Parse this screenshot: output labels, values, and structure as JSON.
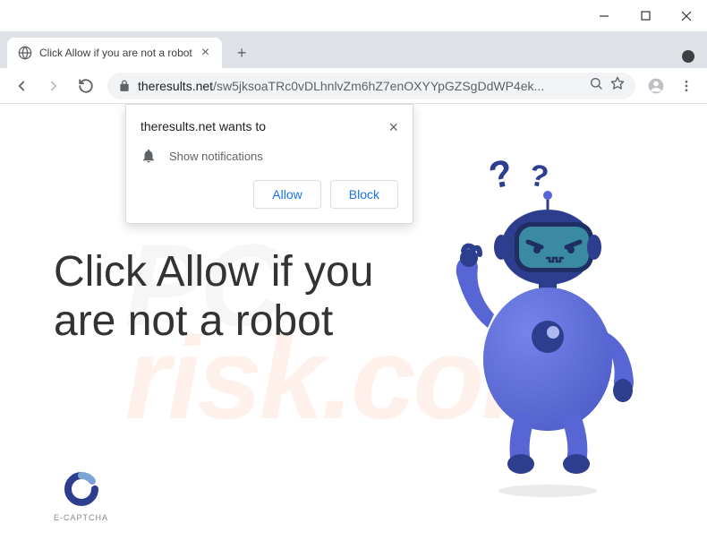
{
  "window": {
    "tab_title": "Click Allow if you are not a robot"
  },
  "addressbar": {
    "domain": "theresults.net",
    "path": "/sw5jksoaTRc0vDLhnlvZm6hZ7enOXYYpGZSgDdWP4ek..."
  },
  "notification": {
    "origin_text": "theresults.net wants to",
    "permission_text": "Show notifications",
    "allow_label": "Allow",
    "block_label": "Block"
  },
  "page": {
    "heading": "Click Allow if you are not a robot",
    "captcha_label": "E-CAPTCHA"
  },
  "watermark": {
    "line1": "PC",
    "line2": "risk.com"
  }
}
